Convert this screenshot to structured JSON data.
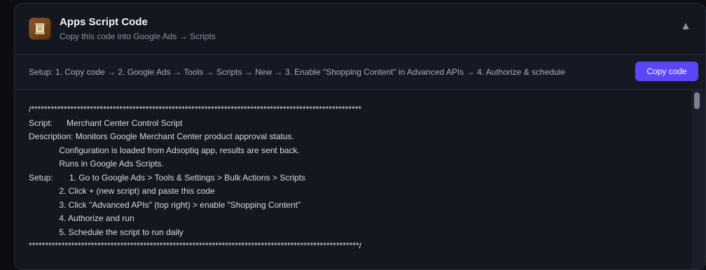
{
  "header": {
    "title": "Apps Script Code",
    "subtitle": "Copy this code into Google Ads → Scripts",
    "icon": "scroll-icon",
    "collapse_icon": "▲"
  },
  "setup": {
    "text": "Setup: 1. Copy code → 2. Google Ads → Tools → Scripts → New → 3. Enable \"Shopping Content\" in Advanced APIs → 4. Authorize & schedule",
    "copy_label": "Copy code"
  },
  "code": {
    "lines": [
      "/*****************************************************************************************************",
      "Script:      Merchant Center Control Script",
      "Description: Monitors Google Merchant Center product approval status.",
      "             Configuration is loaded from Adsoptiq app, results are sent back.",
      "             Runs in Google Ads Scripts.",
      "Setup:       1. Go to Google Ads > Tools & Settings > Bulk Actions > Scripts",
      "             2. Click + (new script) and paste this code",
      "             3. Click \"Advanced APIs\" (top right) > enable \"Shopping Content\"",
      "             4. Authorize and run",
      "             5. Schedule the script to run daily",
      "*****************************************************************************************************/"
    ]
  },
  "colors": {
    "accent": "#5b46f4",
    "background": "#0b0d13",
    "card": "#141720"
  }
}
